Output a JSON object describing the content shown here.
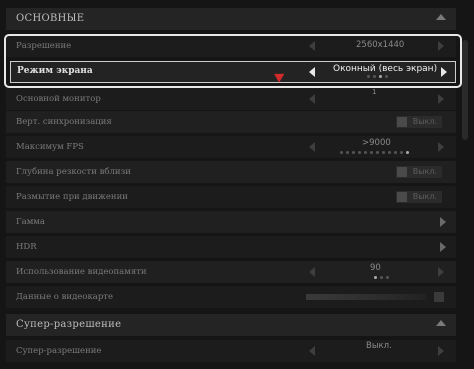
{
  "sections": {
    "main_title": "ОСНОВНЫЕ",
    "super_title": "Супер-разрешение"
  },
  "rows": {
    "resolution": {
      "label": "Разрешение",
      "value": "2560x1440"
    },
    "screen_mode": {
      "label": "Режим экрана",
      "value": "Оконный (весь экран)"
    },
    "monitor": {
      "label": "Основной монитор",
      "value": "1"
    },
    "vsync": {
      "label": "Верт. синхронизация",
      "value": "Выкл."
    },
    "max_fps": {
      "label": "Максимум FPS",
      "value": ">9000"
    },
    "dof": {
      "label": "Глубина резкости вблизи",
      "value": "Выкл."
    },
    "motion_blur": {
      "label": "Размытие при движении",
      "value": "Выкл."
    },
    "gamma": {
      "label": "Гамма"
    },
    "hdr": {
      "label": "HDR"
    },
    "vram": {
      "label": "Использование видеопамяти",
      "value": "90"
    },
    "gpu_info": {
      "label": "Данные о видеокарте"
    },
    "super_res": {
      "label": "Супер-разрешение",
      "value": "Выкл."
    }
  },
  "colors": {
    "accent": "#e8e8e8",
    "cursor": "#d02a2a"
  }
}
